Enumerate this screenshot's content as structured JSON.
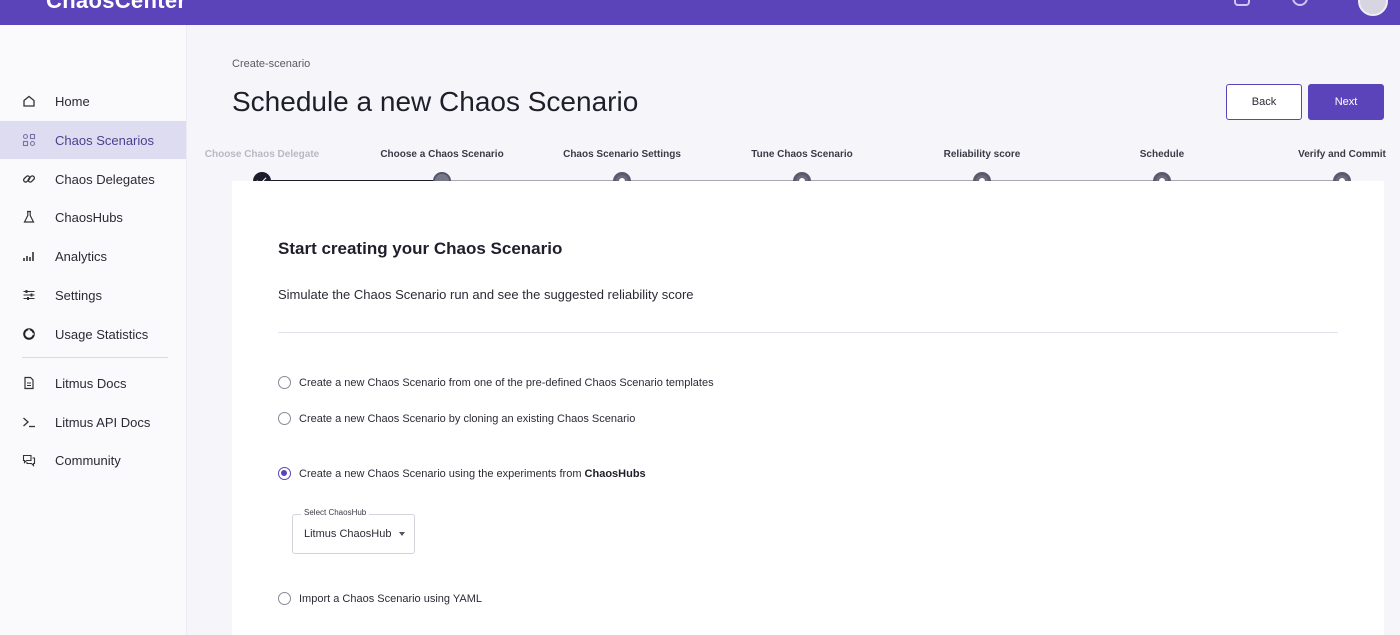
{
  "app": {
    "brand": "ChaosCenter"
  },
  "sidebar": {
    "items": [
      {
        "label": "Home",
        "icon": "home-icon"
      },
      {
        "label": "Chaos Scenarios",
        "icon": "scenarios-icon",
        "active": true
      },
      {
        "label": "Chaos Delegates",
        "icon": "link-icon"
      },
      {
        "label": "ChaosHubs",
        "icon": "flask-icon"
      },
      {
        "label": "Analytics",
        "icon": "analytics-icon"
      },
      {
        "label": "Settings",
        "icon": "settings-icon"
      },
      {
        "label": "Usage Statistics",
        "icon": "pie-icon"
      }
    ],
    "docs": [
      {
        "label": "Litmus Docs",
        "icon": "document-icon"
      },
      {
        "label": "Litmus API Docs",
        "icon": "terminal-icon"
      },
      {
        "label": "Community",
        "icon": "chat-icon"
      }
    ]
  },
  "header": {
    "breadcrumb": "Create-scenario",
    "title": "Schedule a new Chaos Scenario",
    "back_label": "Back",
    "next_label": "Next"
  },
  "stepper": {
    "steps": [
      {
        "label": "Choose Chaos Delegate",
        "state": "done"
      },
      {
        "label": "Choose a Chaos Scenario",
        "state": "current"
      },
      {
        "label": "Chaos Scenario Settings",
        "state": "todo"
      },
      {
        "label": "Tune Chaos Scenario",
        "state": "todo"
      },
      {
        "label": "Reliability score",
        "state": "todo"
      },
      {
        "label": "Schedule",
        "state": "todo"
      },
      {
        "label": "Verify and Commit",
        "state": "todo"
      }
    ]
  },
  "card": {
    "title": "Start creating your Chaos Scenario",
    "subtitle": "Simulate the Chaos Scenario run and see the suggested reliability score",
    "options": [
      {
        "label": "Create a new Chaos Scenario from one of the pre-defined Chaos Scenario templates",
        "checked": false
      },
      {
        "label": "Create a new Chaos Scenario by cloning an existing Chaos Scenario",
        "checked": false
      },
      {
        "label": "Create a new Chaos Scenario using the experiments from ",
        "label_bold": "ChaosHubs",
        "checked": true
      },
      {
        "label": "Import a Chaos Scenario using YAML",
        "checked": false
      }
    ],
    "hub_select": {
      "legend": "Select ChaosHub",
      "value": "Litmus ChaosHub"
    }
  },
  "colors": {
    "accent": "#5b44ba",
    "active_nav": "#dedcf0"
  }
}
